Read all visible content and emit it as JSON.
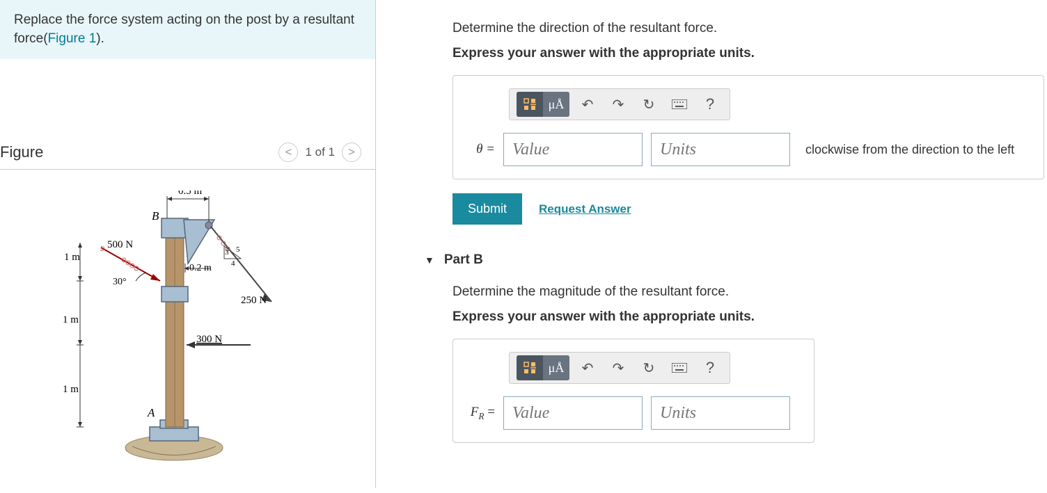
{
  "problem": {
    "text_prefix": "Replace the force system acting on the post by a resultant force(",
    "link_text": "Figure 1",
    "text_suffix": ")."
  },
  "figure": {
    "title": "Figure",
    "nav_prev": "<",
    "nav_count": "1 of 1",
    "nav_next": ">",
    "labels": {
      "top_dim": "0.5 m",
      "B": "B",
      "A": "A",
      "force1": "500 N",
      "dim1": "1 m",
      "angle": "30°",
      "dim2": "0.2 m",
      "tri_3": "3",
      "tri_4": "4",
      "tri_5": "5",
      "force2": "250 N",
      "dim_mid": "1 m",
      "force3": "300 N",
      "dim_bot": "1 m"
    }
  },
  "partA": {
    "question": "Determine the direction of the resultant force.",
    "instruction": "Express your answer with the appropriate units.",
    "toolbar": {
      "units_symbol": "μÅ",
      "help": "?"
    },
    "var_label": "θ =",
    "value_placeholder": "Value",
    "units_placeholder": "Units",
    "suffix": "clockwise from the direction to the left",
    "submit": "Submit",
    "request": "Request Answer"
  },
  "partB": {
    "title": "Part B",
    "question": "Determine the magnitude of the resultant force.",
    "instruction": "Express your answer with the appropriate units.",
    "toolbar": {
      "units_symbol": "μÅ",
      "help": "?"
    },
    "var_label_prefix": "F",
    "var_label_sub": "R",
    "var_label_suffix": " =",
    "value_placeholder": "Value",
    "units_placeholder": "Units"
  }
}
